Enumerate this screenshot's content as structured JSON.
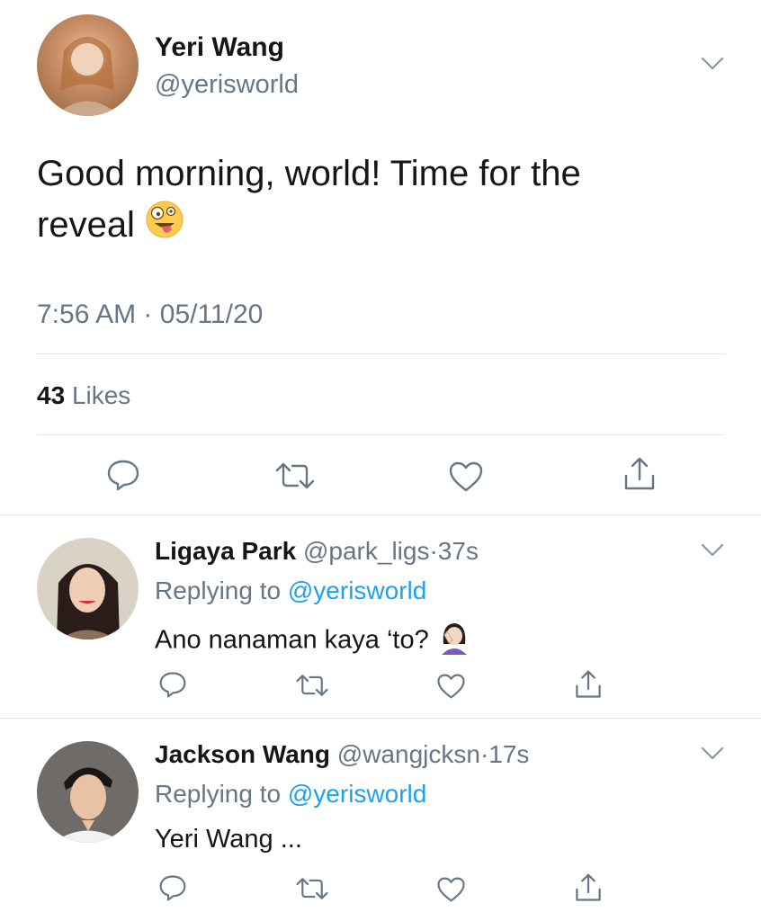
{
  "main_tweet": {
    "author_name": "Yeri Wang",
    "author_handle": "@yerisworld",
    "text": "Good morning, world! Time for the reveal",
    "emoji": "zany-face",
    "time": "7:56 AM",
    "separator": "·",
    "date": "05/11/20",
    "likes_count": "43",
    "likes_label": "Likes"
  },
  "replies": [
    {
      "author_name": "Ligaya Park",
      "author_handle": "@park_ligs",
      "separator": "·",
      "time": "37s",
      "replying_prefix": "Replying to",
      "replying_handle": "@yerisworld",
      "text": "Ano nanaman kaya ‘to?",
      "emoji": "woman-facepalming"
    },
    {
      "author_name": "Jackson Wang",
      "author_handle": "@wangjcksn",
      "separator": "·",
      "time": "17s",
      "replying_prefix": "Replying to",
      "replying_handle": "@yerisworld",
      "text": "Yeri Wang ..."
    }
  ],
  "icons": [
    "chevron-down-icon",
    "reply-icon",
    "retweet-icon",
    "like-icon",
    "share-icon"
  ],
  "colors": {
    "link": "#1da1f2",
    "muted": "#657786",
    "text": "#14171a",
    "divider": "#e1e8ed"
  }
}
